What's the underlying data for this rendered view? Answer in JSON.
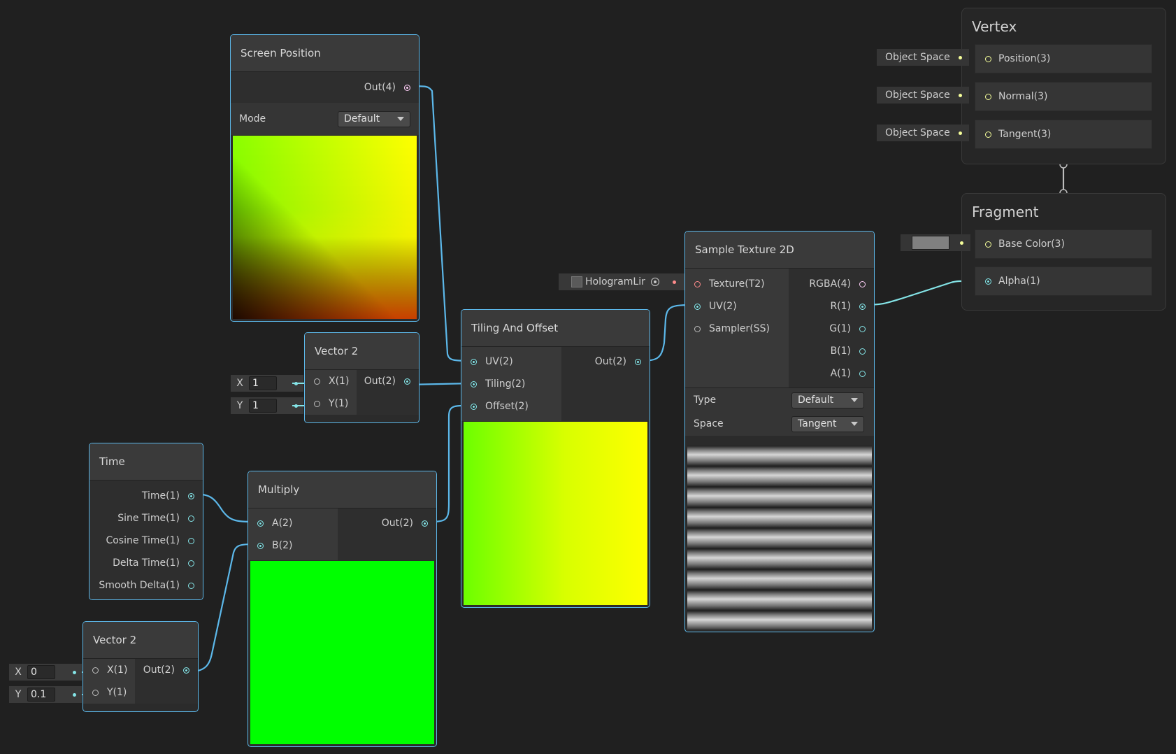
{
  "screen_position": {
    "title": "Screen Position",
    "out_port": "Out(4)",
    "mode_label": "Mode",
    "mode_value": "Default"
  },
  "vector2_a": {
    "title": "Vector 2",
    "inputs": [
      "X(1)",
      "Y(1)"
    ],
    "output": "Out(2)",
    "x_label": "X",
    "x_value": "1",
    "y_label": "Y",
    "y_value": "1"
  },
  "time": {
    "title": "Time",
    "outputs": [
      "Time(1)",
      "Sine Time(1)",
      "Cosine Time(1)",
      "Delta Time(1)",
      "Smooth Delta(1)"
    ]
  },
  "vector2_b": {
    "title": "Vector 2",
    "inputs": [
      "X(1)",
      "Y(1)"
    ],
    "output": "Out(2)",
    "x_label": "X",
    "x_value": "0",
    "y_label": "Y",
    "y_value": "0.1"
  },
  "multiply": {
    "title": "Multiply",
    "inputs": [
      "A(2)",
      "B(2)"
    ],
    "output": "Out(2)"
  },
  "tiling_offset": {
    "title": "Tiling And Offset",
    "inputs": [
      "UV(2)",
      "Tiling(2)",
      "Offset(2)"
    ],
    "output": "Out(2)"
  },
  "sample_texture": {
    "title": "Sample Texture 2D",
    "inputs": [
      "Texture(T2)",
      "UV(2)",
      "Sampler(SS)"
    ],
    "outputs": [
      "RGBA(4)",
      "R(1)",
      "G(1)",
      "B(1)",
      "A(1)"
    ],
    "type_label": "Type",
    "type_value": "Default",
    "space_label": "Space",
    "space_value": "Tangent",
    "texture_field": "HologramLir"
  },
  "vertex": {
    "title": "Vertex",
    "blocks": [
      "Position(3)",
      "Normal(3)",
      "Tangent(3)"
    ],
    "space_fields": [
      "Object Space",
      "Object Space",
      "Object Space"
    ]
  },
  "fragment": {
    "title": "Fragment",
    "blocks": [
      "Base Color(3)",
      "Alpha(1)"
    ]
  },
  "colors": {
    "background": "#202020",
    "node_border": "#5cb8ea",
    "wire_vector": "#5cb8ea",
    "wire_float": "#84e4e7",
    "port_texture": "#ff8b8b",
    "port_vector3": "#f6ff9a",
    "port_vector4": "#fbcbf4"
  }
}
